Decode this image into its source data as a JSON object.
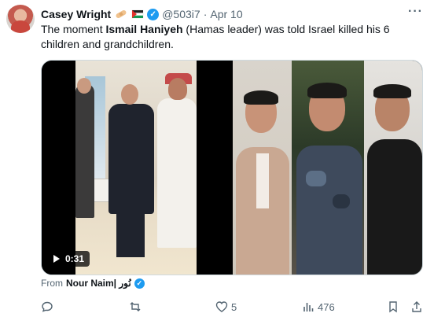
{
  "author": {
    "name": "Casey Wright",
    "emoji": [
      "bandage-emoji",
      "flag-emoji"
    ],
    "handle": "@503i7",
    "separator": "·",
    "date": "Apr 10"
  },
  "more_label": "···",
  "tweet_text": {
    "part1": "The moment ",
    "bold": "Ismail Haniyeh",
    "part2": " (Hamas leader) was told Israel killed his 6 children and grandchildren."
  },
  "media": {
    "video_duration": "0:31"
  },
  "source": {
    "prefix": "From",
    "name": "Nour Naim| نُور"
  },
  "actions": {
    "reply_count": "",
    "retweet_count": "",
    "like_count": "5",
    "views_count": "476"
  },
  "colors": {
    "accent": "#1d9bf0",
    "text": "#0f1419",
    "muted": "#536471"
  }
}
